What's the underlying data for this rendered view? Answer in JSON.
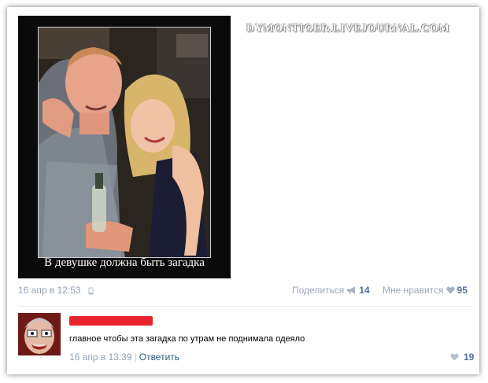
{
  "watermark": "DYMONTIGER.LIVEJOURNAL.COM",
  "post": {
    "image_caption": "В девушке должна быть загадка",
    "date": "16 апр в 12:53",
    "share_label": "Поделиться",
    "share_count": "14",
    "like_label": "Мне нравится",
    "like_count": "95"
  },
  "comment": {
    "author_redacted": true,
    "text": "главное чтобы эта загадка по утрам не поднимала одеяло",
    "date": "16 апр в 13:39",
    "reply_label": "Ответить",
    "like_count": "19"
  },
  "colors": {
    "meta_text": "#93a1b5",
    "count_text": "#4f6f94",
    "link": "#2b587a",
    "redaction": "#e8232b"
  },
  "icons": {
    "post_device": "phone-icon",
    "share": "megaphone-icon",
    "like": "heart-icon"
  }
}
